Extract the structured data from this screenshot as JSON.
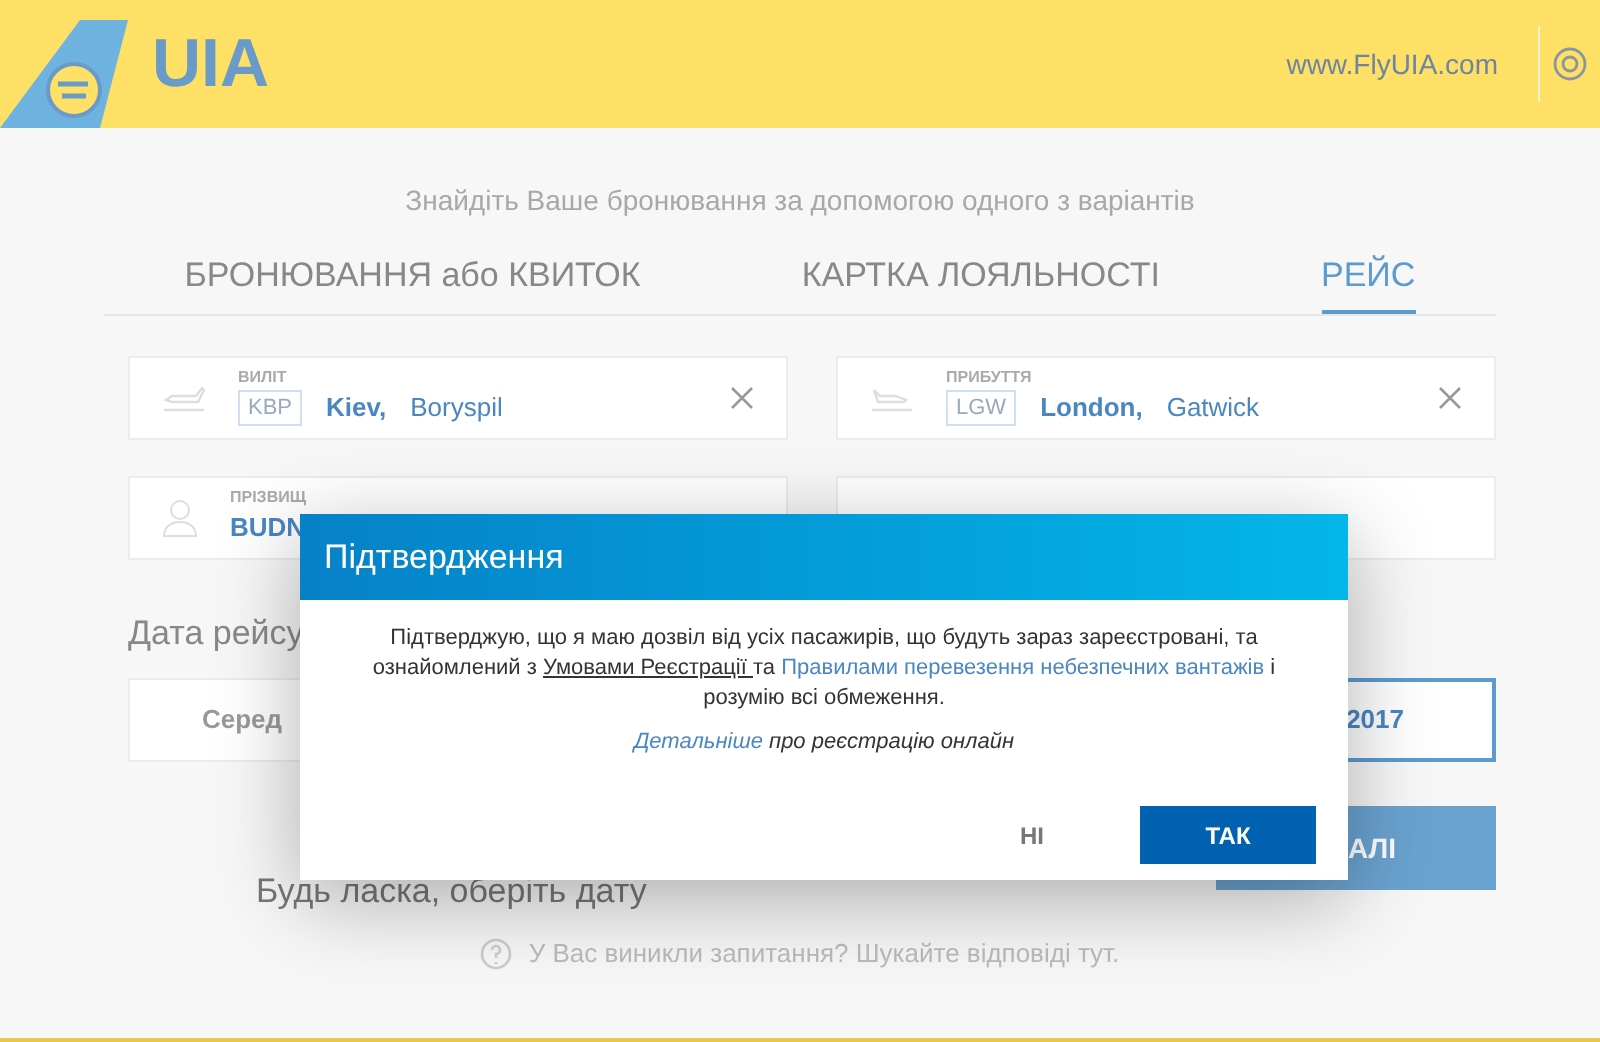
{
  "header": {
    "logo": "UIA",
    "site": "www.FlyUIA.com"
  },
  "subtitle": "Знайдіть Ваше бронювання за допомогою одного з варіантів",
  "tabs": [
    {
      "label": "БРОНЮВАННЯ або КВИТОК",
      "selected": false
    },
    {
      "label": "КАРТКА ЛОЯЛЬНОСТІ",
      "selected": false
    },
    {
      "label": "РЕЙС",
      "selected": true
    }
  ],
  "departure": {
    "label": "ВИЛІТ",
    "code": "KBP",
    "city": "Kiev,",
    "airport": "Boryspil"
  },
  "arrival": {
    "label": "ПРИБУТТЯ",
    "code": "LGW",
    "city": "London,",
    "airport": "Gatwick"
  },
  "surname": {
    "label": "ПРІЗВИЩ",
    "value": "BUDN"
  },
  "date_label": "Дата рейсу",
  "date_options": [
    {
      "label": "Серед",
      "selected": false
    },
    {
      "label": "2017",
      "selected": true
    }
  ],
  "date_hint": "Будь ласка, оберіть дату",
  "submit": "АЛІ",
  "help": "У Вас виникли запитання? Шукайте відповіді тут.",
  "dialog": {
    "title": "Підтвердження",
    "text_before": "Підтверджую, що я маю дозвіл від усіх пасажирів, що будуть зараз зареєстровані, та ознайомлений з ",
    "link_terms": "Умовами Реєстрації ",
    "text_mid": "та ",
    "link_rules": "Правилами перевезення небезпечних вантажів",
    "text_after": " і розумію всі обмеження.",
    "more_link": "Детальніше",
    "more_text": " про реєстрацію онлайн",
    "buttons": [
      {
        "label": "НІ",
        "kind": "secondary"
      },
      {
        "label": "ТАК",
        "kind": "primary"
      }
    ]
  }
}
